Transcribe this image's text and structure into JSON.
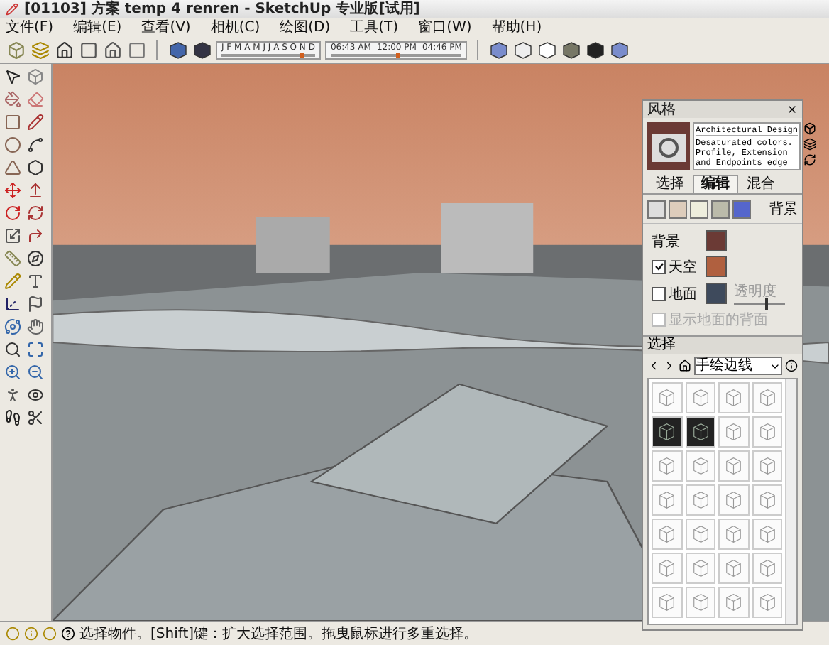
{
  "window": {
    "title": "[01103] 方案 temp 4 renren - SketchUp 专业版[试用]"
  },
  "menu": [
    "文件(F)",
    "编辑(E)",
    "查看(V)",
    "相机(C)",
    "绘图(D)",
    "工具(T)",
    "窗口(W)",
    "帮助(H)"
  ],
  "shadow_toolbar": {
    "month_slider": {
      "months": "J F M A M J J A S O N D",
      "level": 0.83
    },
    "time_slider": {
      "times": [
        "06:43 AM",
        "12:00 PM",
        "04:46 PM"
      ],
      "level": 0.5
    }
  },
  "styles_panel": {
    "title": "风格",
    "style_name": "Architectural Design",
    "style_description": "Desaturated colors. Profile, Extension and Endpoints edge",
    "tabs": [
      {
        "label": "选择",
        "selected": false
      },
      {
        "label": "编辑",
        "selected": true
      },
      {
        "label": "混合",
        "selected": false
      }
    ],
    "section_label": "背景",
    "settings": [
      {
        "kind": "color",
        "label": "背景",
        "color": "#6b3a35"
      },
      {
        "kind": "check",
        "label": "天空",
        "checked": true,
        "color": "#b0603f"
      },
      {
        "kind": "check",
        "label": "地面",
        "checked": false,
        "color": "#3e4a5c",
        "slider_label": "透明度",
        "level": 0.6
      },
      {
        "kind": "check",
        "label": "显示地面的背面",
        "checked": false,
        "disabled": true
      }
    ],
    "select_label": "选择",
    "collection": "手绘边线",
    "thumbnails": [
      {
        "kind": "light"
      },
      {
        "kind": "light"
      },
      {
        "kind": "light"
      },
      {
        "kind": "light"
      },
      {
        "kind": "dark"
      },
      {
        "kind": "dark"
      },
      {
        "kind": "light"
      },
      {
        "kind": "light"
      },
      {
        "kind": "light"
      },
      {
        "kind": "light"
      },
      {
        "kind": "light"
      },
      {
        "kind": "light"
      },
      {
        "kind": "light"
      },
      {
        "kind": "light"
      },
      {
        "kind": "light"
      },
      {
        "kind": "light"
      },
      {
        "kind": "light"
      },
      {
        "kind": "light"
      },
      {
        "kind": "light"
      },
      {
        "kind": "light"
      },
      {
        "kind": "light"
      },
      {
        "kind": "light"
      },
      {
        "kind": "light"
      },
      {
        "kind": "light"
      },
      {
        "kind": "light"
      },
      {
        "kind": "light"
      },
      {
        "kind": "light"
      },
      {
        "kind": "light"
      }
    ]
  },
  "status_bar": {
    "message": "选择物件。[Shift]键：扩大选择范围。拖曳鼠标进行多重选择。"
  }
}
